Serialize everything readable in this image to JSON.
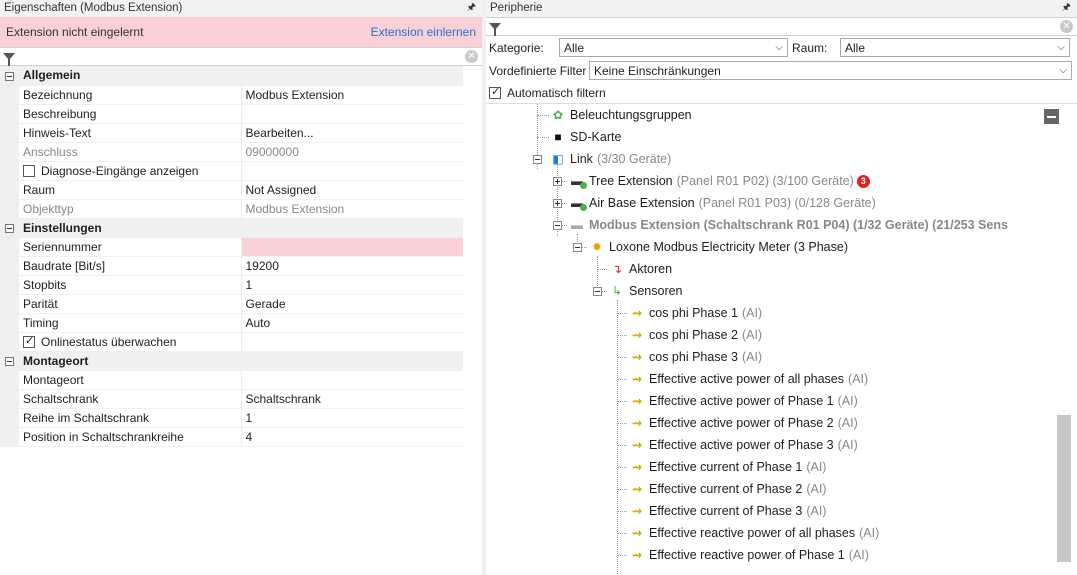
{
  "left_panel": {
    "title": "Eigenschaften (Modbus Extension)",
    "pin_glyph": "❘",
    "banner": {
      "text": "Extension nicht eingelernt",
      "link": "Extension einlernen"
    },
    "sections": [
      {
        "label": "Allgemein",
        "rows": [
          {
            "name": "Bezeichnung",
            "value": "Modbus Extension"
          },
          {
            "name": "Beschreibung",
            "value": ""
          },
          {
            "name": "Hinweis-Text",
            "value": "Bearbeiten..."
          },
          {
            "name": "Anschluss",
            "value": "09000000",
            "disabled": true
          },
          {
            "checkbox": true,
            "checked": false,
            "name": "Diagnose-Eingänge anzeigen"
          },
          {
            "name": "Raum",
            "value": "Not Assigned"
          },
          {
            "name": "Objekttyp",
            "value": "Modbus Extension",
            "disabled": true
          }
        ]
      },
      {
        "label": "Einstellungen",
        "rows": [
          {
            "name": "Seriennummer",
            "value": "",
            "highlight": true
          },
          {
            "name": "Baudrate [Bit/s]",
            "value": "19200"
          },
          {
            "name": "Stopbits",
            "value": "1"
          },
          {
            "name": "Parität",
            "value": "Gerade"
          },
          {
            "name": "Timing",
            "value": "Auto"
          },
          {
            "checkbox": true,
            "checked": true,
            "name": "Onlinestatus überwachen"
          }
        ]
      },
      {
        "label": "Montageort",
        "rows": [
          {
            "name": "Montageort",
            "value": ""
          },
          {
            "name": "Schaltschrank",
            "value": "Schaltschrank"
          },
          {
            "name": "Reihe im Schaltschrank",
            "value": "1"
          },
          {
            "name": "Position in Schaltschrankreihe",
            "value": "4"
          }
        ]
      }
    ]
  },
  "right_panel": {
    "title": "Peripherie",
    "kategorie_label": "Kategorie:",
    "kategorie_value": "Alle",
    "raum_label": "Raum:",
    "raum_value": "Alle",
    "filter_label": "Vordefinierte Filter",
    "filter_value": "Keine Einschränkungen",
    "auto_filter_label": "Automatisch filtern",
    "tree": {
      "beleuchtung": "Beleuchtungsgruppen",
      "sdkarte": "SD-Karte",
      "link": {
        "label": "Link",
        "meta": "(3/30 Geräte)"
      },
      "tree_ext": {
        "label": "Tree Extension",
        "meta": "(Panel R01 P02) (3/100 Geräte)",
        "badge": "3"
      },
      "air_ext": {
        "label": "Air Base Extension",
        "meta": "(Panel R01 P03) (0/128 Geräte)"
      },
      "modbus_ext": {
        "label": "Modbus Extension (Schaltschrank R01 P04) (1/32 Geräte) (21/253 Sens"
      },
      "meter": "Loxone Modbus Electricity Meter (3 Phase)",
      "aktoren": "Aktoren",
      "sensoren": "Sensoren",
      "ai_suffix": "(AI)",
      "sensors": [
        "cos phi Phase 1",
        "cos phi Phase 2",
        "cos phi Phase 3",
        "Effective active power of all phases",
        "Effective active power of Phase 1",
        "Effective active power of Phase 2",
        "Effective active power of Phase 3",
        "Effective current of Phase 1",
        "Effective current of Phase 2",
        "Effective current of Phase 3",
        "Effective reactive power of all phases",
        "Effective reactive power of Phase 1"
      ]
    }
  }
}
